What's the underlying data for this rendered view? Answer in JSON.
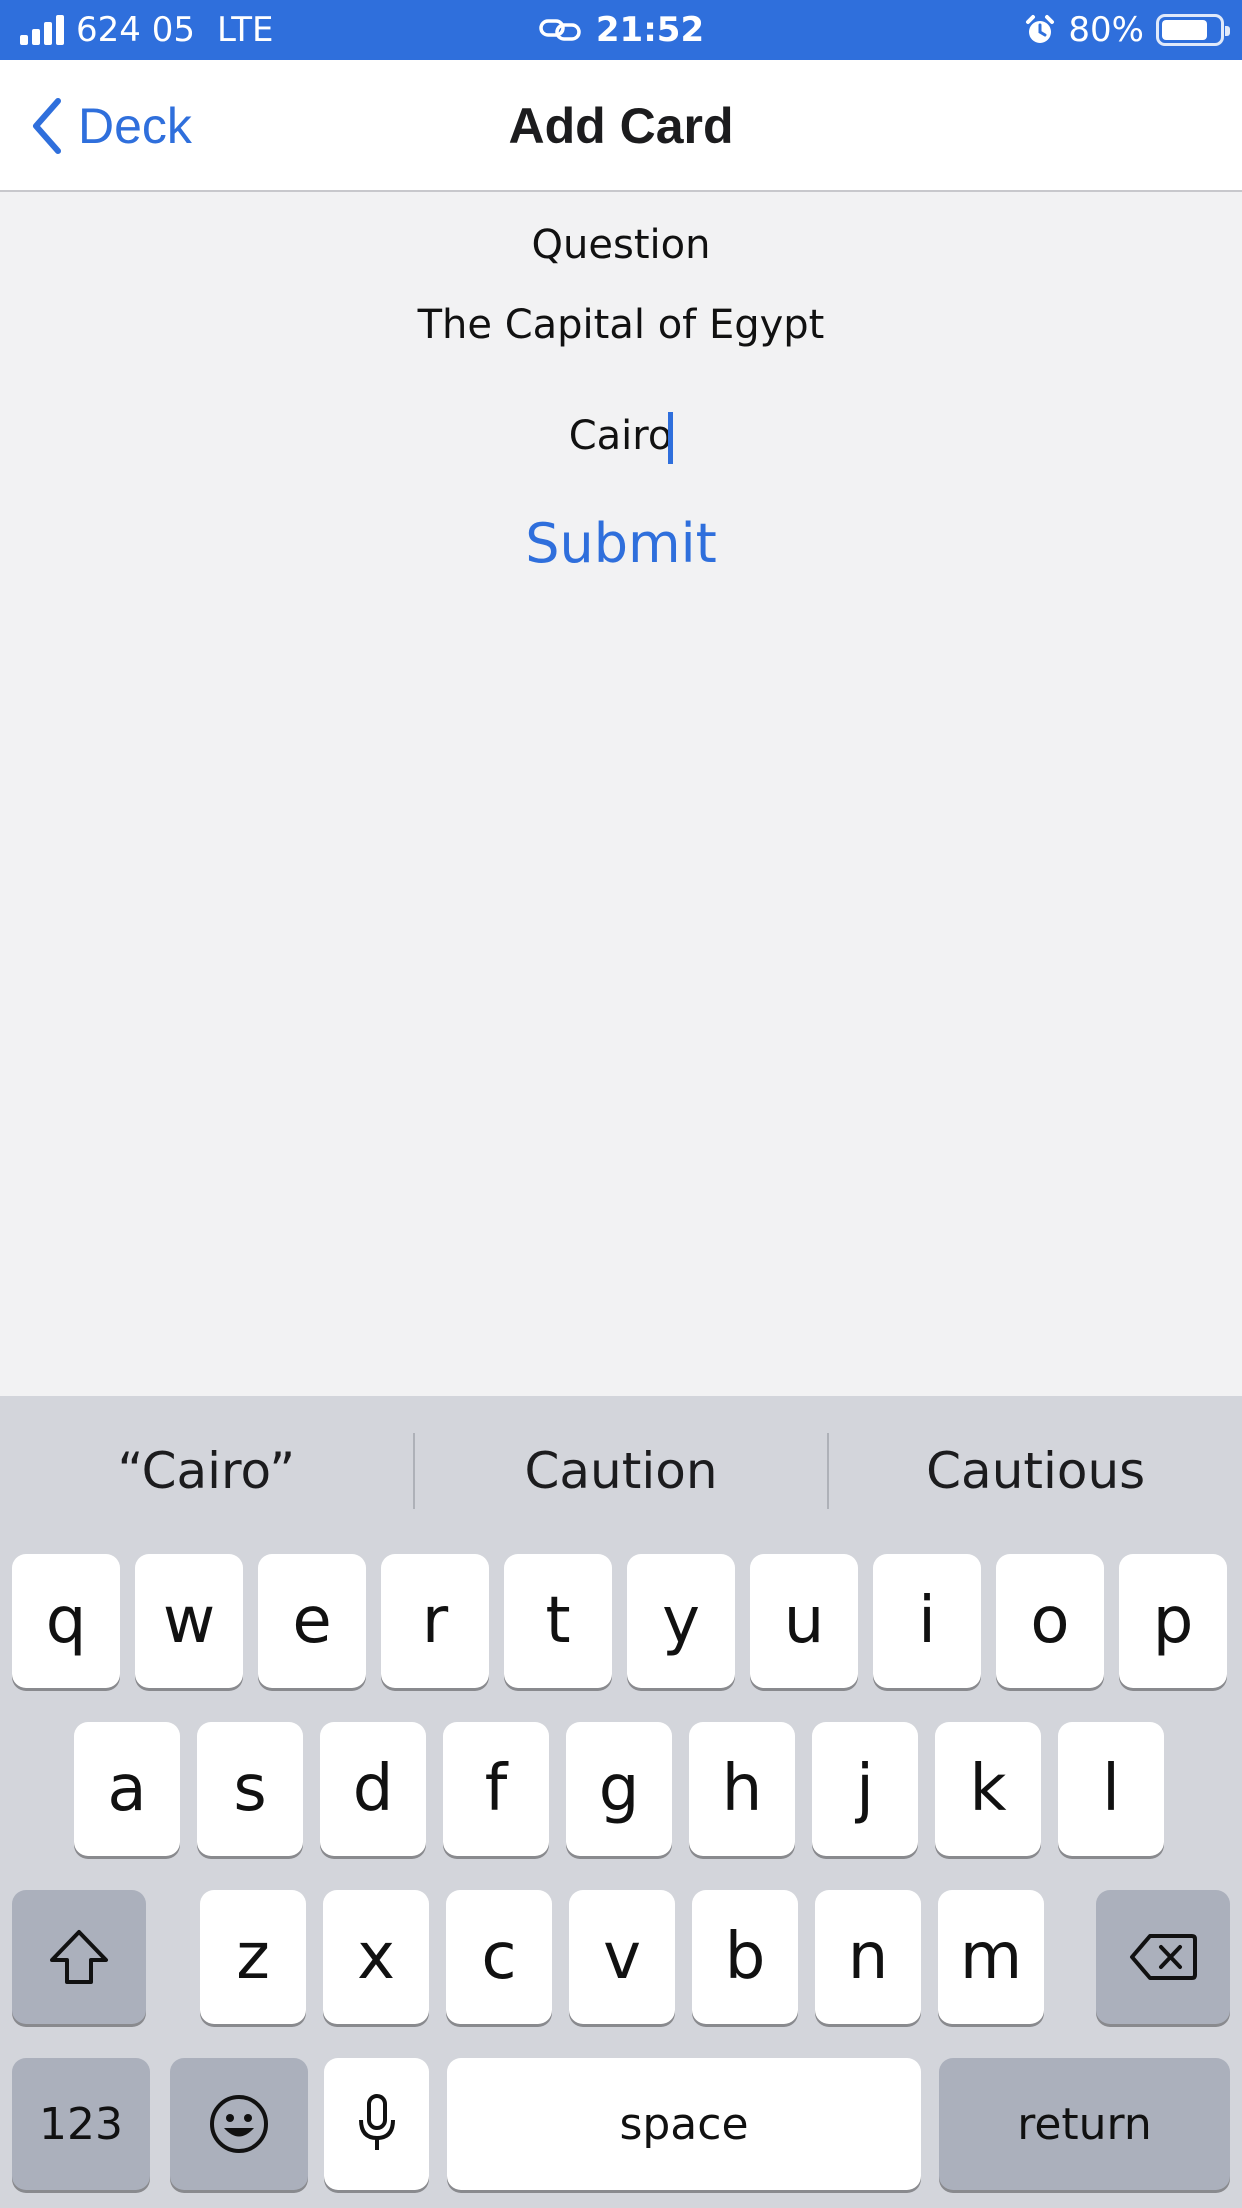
{
  "status_bar": {
    "carrier": "624 05",
    "network": "LTE",
    "time": "21:52",
    "battery": "80%",
    "battery_level": 0.8
  },
  "nav": {
    "back_label": "Deck",
    "title": "Add Card"
  },
  "form": {
    "question_label": "Question",
    "question_value": "The Capital of Egypt",
    "answer_value": "Cairo",
    "submit_label": "Submit"
  },
  "keyboard": {
    "suggestions": [
      "“Cairo”",
      "Caution",
      "Cautious"
    ],
    "row1": [
      "q",
      "w",
      "e",
      "r",
      "t",
      "y",
      "u",
      "i",
      "o",
      "p"
    ],
    "row2": [
      "a",
      "s",
      "d",
      "f",
      "g",
      "h",
      "j",
      "k",
      "l"
    ],
    "row3": [
      "z",
      "x",
      "c",
      "v",
      "b",
      "n",
      "m"
    ],
    "numbers_label": "123",
    "space_label": "space",
    "return_label": "return"
  },
  "colors": {
    "accent": "#2f6fdc",
    "background": "#f2f2f3",
    "keyboard": "#d3d5db"
  }
}
